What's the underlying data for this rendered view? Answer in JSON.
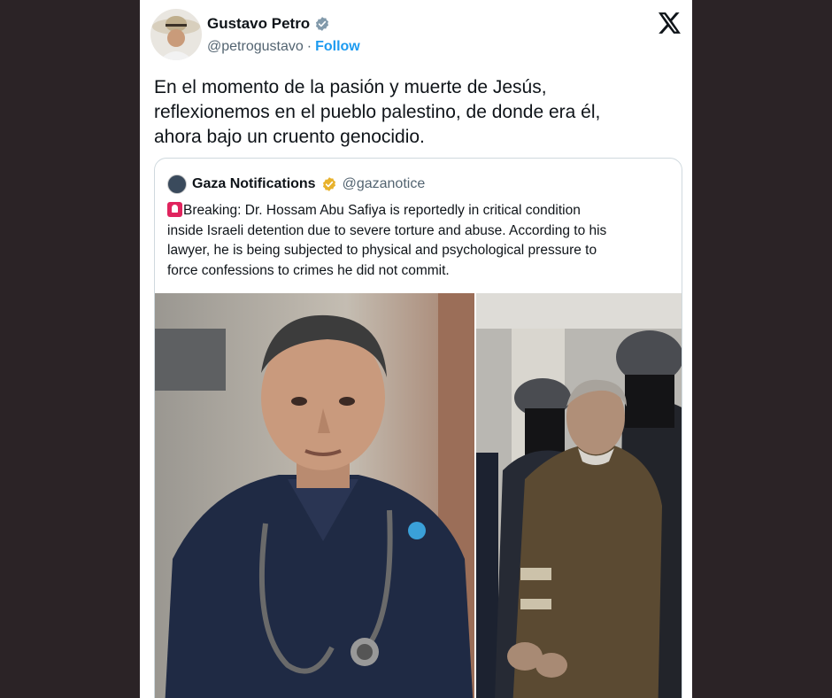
{
  "tweet": {
    "author_name": "Gustavo Petro",
    "author_handle": "@petrogustavo",
    "separator": "·",
    "follow_label": "Follow",
    "text_lines": [
      "En el momento de la pasión y muerte de Jesús,",
      "reflexionemos en el pueblo palestino, de donde era él,",
      "ahora bajo un cruento genocidio."
    ]
  },
  "quote": {
    "author_name": "Gaza Notifications",
    "author_handle": "@gazanotice",
    "text_lines": [
      "Breaking: Dr. Hossam Abu Safiya is reportedly in critical condition",
      "inside Israeli detention due to severe torture and abuse. According to his",
      "lawyer, he is being subjected to physical and psychological pressure to",
      "force confessions to crimes he did not commit."
    ],
    "media": [
      {
        "description_icon": "photo-doctor-portrait"
      },
      {
        "description_icon": "photo-detainee-escorted"
      }
    ]
  },
  "colors": {
    "background": "#2b2326",
    "card": "#ffffff",
    "accent": "#1d9bf0",
    "text_primary": "#0f1419",
    "text_secondary": "#536471",
    "gold_verified": "#e8b22c"
  }
}
